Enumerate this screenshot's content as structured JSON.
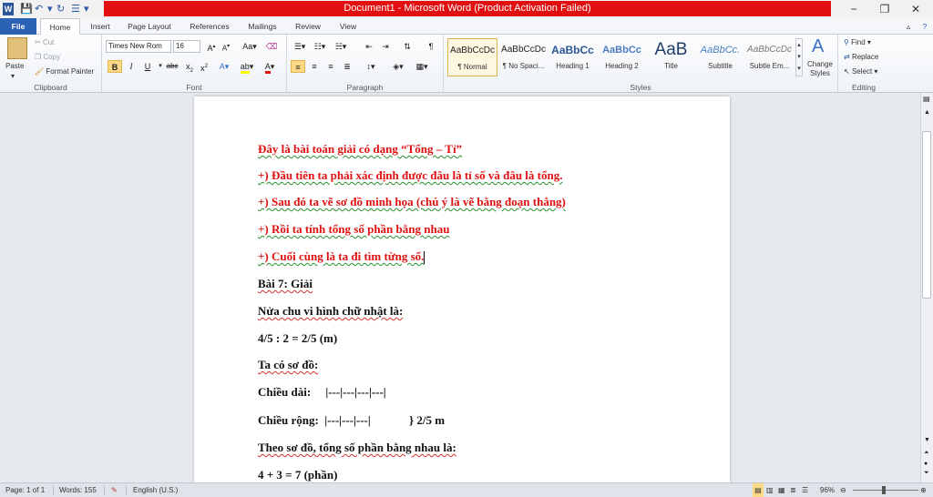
{
  "window": {
    "title": "Document1 - Microsoft Word (Product Activation Failed)",
    "controls": [
      "−",
      "❐",
      "✕"
    ]
  },
  "tabs": [
    "File",
    "Home",
    "Insert",
    "Page Layout",
    "References",
    "Mailings",
    "Review",
    "View"
  ],
  "ribbon": {
    "clipboard": {
      "label": "Clipboard",
      "paste": "Paste",
      "cut": "Cut",
      "copy": "Copy",
      "format_painter": "Format Painter"
    },
    "font": {
      "label": "Font",
      "font_name": "Times New Rom",
      "font_size": "16"
    },
    "paragraph": {
      "label": "Paragraph"
    },
    "styles": {
      "label": "Styles",
      "items": [
        {
          "preview": "AaBbCcDc",
          "name": "¶ Normal"
        },
        {
          "preview": "AaBbCcDc",
          "name": "¶ No Spaci..."
        },
        {
          "preview": "AaBbCc",
          "name": "Heading 1"
        },
        {
          "preview": "AaBbCc",
          "name": "Heading 2"
        },
        {
          "preview": "AaB",
          "name": "Title"
        },
        {
          "preview": "AaBbCc.",
          "name": "Subtitle"
        },
        {
          "preview": "AaBbCcDc",
          "name": "Subtle Em..."
        }
      ],
      "change_styles": "Change Styles"
    },
    "editing": {
      "label": "Editing",
      "find": "Find",
      "replace": "Replace",
      "select": "Select"
    }
  },
  "document": {
    "lines": [
      {
        "text": "Đây là bài toán giải có dạng “Tổng – Tỉ”"
      },
      {
        "text": "+) Đầu tiên ta phải xác định được đâu là tỉ số và đâu là tổng."
      },
      {
        "text": "+) Sau đó ta vẽ sơ đồ minh họa (chú ý là vẽ bằng đoạn thẳng)"
      },
      {
        "text": "+) Rồi ta tính tổng số phần bằng nhau"
      },
      {
        "text": "+) Cuối cùng là ta đi tìm từng số."
      },
      {
        "text": "Bài 7: Giải"
      },
      {
        "text": "Nửa chu vi hình chữ nhật là:"
      },
      {
        "text": "4/5 : 2 = 2/5 (m)"
      },
      {
        "text": "Ta có sơ đồ:"
      },
      {
        "text": "Chiều dài:     |---|---|---|---|"
      },
      {
        "text": "Chiều rộng:  |---|---|---|             } 2/5 m"
      },
      {
        "text": "Theo sơ đồ, tổng số phần bằng nhau là:"
      },
      {
        "text": "4 + 3 = 7 (phần)"
      }
    ]
  },
  "status": {
    "page": "Page: 1 of 1",
    "words": "Words: 155",
    "language": "English (U.S.)",
    "zoom": "96%"
  },
  "colors": {
    "file_tab": "#2c62b4",
    "title_warning": "#e10f10",
    "doc_red_text": "#e01010"
  }
}
